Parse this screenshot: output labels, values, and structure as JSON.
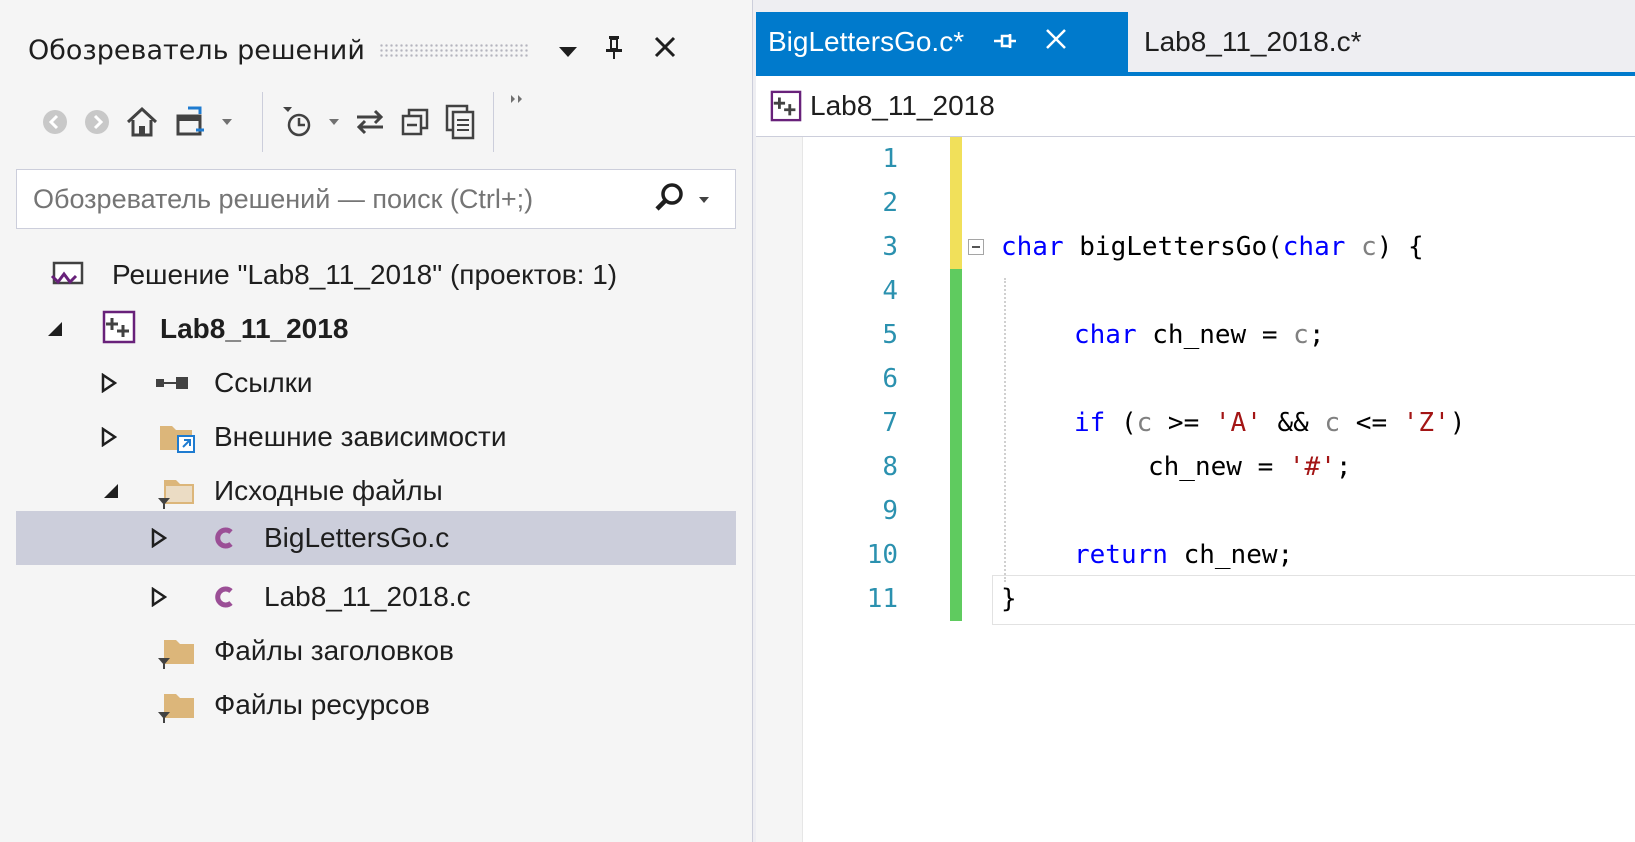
{
  "solution_explorer": {
    "title": "Обозреватель решений",
    "search_placeholder": "Обозреватель решений — поиск (Ctrl+;)",
    "tree": [
      {
        "label": "Решение \"Lab8_11_2018\"  (проектов: 1)",
        "icon": "solution-icon",
        "expander": "none"
      },
      {
        "label": "Lab8_11_2018",
        "icon": "cpp-project-icon",
        "expander": "expanded",
        "bold": true
      },
      {
        "label": "Ссылки",
        "icon": "references-icon",
        "expander": "collapsed"
      },
      {
        "label": "Внешние зависимости",
        "icon": "external-deps-folder-icon",
        "expander": "collapsed"
      },
      {
        "label": "Исходные файлы",
        "icon": "filter-folder-icon",
        "expander": "expanded"
      },
      {
        "label": "BigLettersGo.c",
        "icon": "c-file-icon",
        "expander": "collapsed",
        "selected": true
      },
      {
        "label": "Lab8_11_2018.c",
        "icon": "c-file-icon",
        "expander": "collapsed"
      },
      {
        "label": "Файлы заголовков",
        "icon": "filter-folder-icon",
        "expander": "none"
      },
      {
        "label": "Файлы ресурсов",
        "icon": "filter-folder-icon",
        "expander": "none"
      }
    ]
  },
  "editor": {
    "tabs": [
      {
        "label": "BigLettersGo.c*",
        "active": true
      },
      {
        "label": "Lab8_11_2018.c*",
        "active": false
      }
    ],
    "navbar_project": "Lab8_11_2018",
    "lines": [
      {
        "n": "1",
        "change": "yellow"
      },
      {
        "n": "2",
        "change": "yellow"
      },
      {
        "n": "3",
        "change": "yellow"
      },
      {
        "n": "4",
        "change": "green"
      },
      {
        "n": "5",
        "change": "green"
      },
      {
        "n": "6",
        "change": "green"
      },
      {
        "n": "7",
        "change": "green"
      },
      {
        "n": "8",
        "change": "green"
      },
      {
        "n": "9",
        "change": "green"
      },
      {
        "n": "10",
        "change": "green"
      },
      {
        "n": "11",
        "change": "green"
      }
    ],
    "code": {
      "l3_kw1": "char",
      "l3_fn": " bigLettersGo(",
      "l3_kw2": "char",
      "l3_par": "c",
      "l3_end": ") {",
      "l5_kw": "char",
      "l5_a": " ch_new = ",
      "l5_par": "c",
      "l5_end": ";",
      "l7_kw": "if",
      "l7_a": " (",
      "l7_p1": "c",
      "l7_b": " >= ",
      "l7_s1": "'A'",
      "l7_c": " && ",
      "l7_p2": "c",
      "l7_d": " <= ",
      "l7_s2": "'Z'",
      "l7_end": ")",
      "l8_a": "ch_new = ",
      "l8_s": "'#'",
      "l8_end": ";",
      "l10_kw": "return",
      "l10_a": " ch_new;",
      "l11": "}"
    }
  },
  "colors": {
    "accent": "#007acc",
    "change_yellow": "#f1e05a",
    "change_green": "#5fcb5f",
    "keyword": "#0000ff",
    "string": "#a31515",
    "line_number": "#2b91af"
  }
}
